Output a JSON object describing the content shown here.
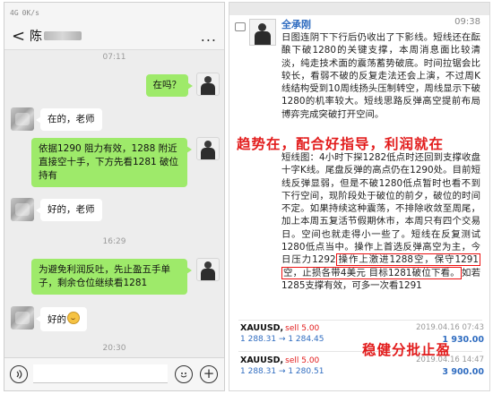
{
  "phone": {
    "status": {
      "signal": "4G",
      "speed": "0K/s"
    },
    "header": {
      "back": "<",
      "title": "陈",
      "menu": "..."
    },
    "timestamps": [
      "07:11",
      "16:29",
      "20:30"
    ],
    "messages": [
      {
        "from": "me",
        "text": "在吗？"
      },
      {
        "from": "other",
        "text": "在的，老师"
      },
      {
        "from": "me",
        "text": "依据1290 阻力有效，1288 附近直接空十手，下方先看1281 破位持有"
      },
      {
        "from": "other",
        "text": "好的，老师"
      },
      {
        "from": "me",
        "text": "为避免利润反吐，先止盈五手单子，剩余仓位继续看1281"
      },
      {
        "from": "other",
        "text": "好的"
      }
    ],
    "input": {
      "voice_icon": "voice-icon",
      "emoji_icon": "emoji-icon",
      "plus_icon": "plus-icon",
      "plus": "+"
    }
  },
  "post": {
    "author": "全承刚",
    "time": "09:38",
    "para1": "日图连阴下下行后仍收出了下影线。短线还在酝酿下破1280的关键支撑，本周消息面比较清淡，纯走技术面的震荡蓄势破底。时间拉锯会比较长，看弱不破的反复走法还会上演，不过周K线结构受到10周线扬头压制转空，周线显示下破1280的机率较大。短线思路反弹高空提前布局博弈完成突破打开空间。",
    "slogan1": "趋势在，配合好指导，利润就在",
    "para2_a": "短线图：4小时下探1282低点时还回到支撑收盘十字K线。尾盘反弹的高点仍在1290处。目前短线反弹显弱，但是不破1280低点暂时也看不到下行空间，现阶段处于破位的前夕，破位的时间不定。如果持续这种震荡，不排除收敛至周尾，加上本周五复活节假期休市，本周只有四个交易日。空间也就走得小一些了。短线在反复测试1280低点当中。操作上首选反弹高空为主，今日压力1292",
    "para2_hl1": "操作上激进1288空，保守1291",
    "para2_hl2": "空，止损各带4美元 目标1281破位下看。",
    "para2_tail": "如若1285支撑有效，可多一次看1291",
    "slogan2": "稳健分批止盈",
    "trades": [
      {
        "symbol": "XAUUSD,",
        "side": "sell 5.00",
        "date": "2019.04.16 07:43",
        "prices": "1 288.31 → 1 284.45",
        "pnl": "1 930.00"
      },
      {
        "symbol": "XAUUSD,",
        "side": "sell 5.00",
        "date": "2019.04.16 14:47",
        "prices": "1 288.31 → 1 280.51",
        "pnl": "3 900.00"
      }
    ]
  },
  "colors": {
    "bubble_me": "#9eea6a",
    "bubble_other": "#ffffff",
    "chat_bg": "#ededed",
    "accent_red": "#e21c1c",
    "link_blue": "#2f6cc0"
  }
}
